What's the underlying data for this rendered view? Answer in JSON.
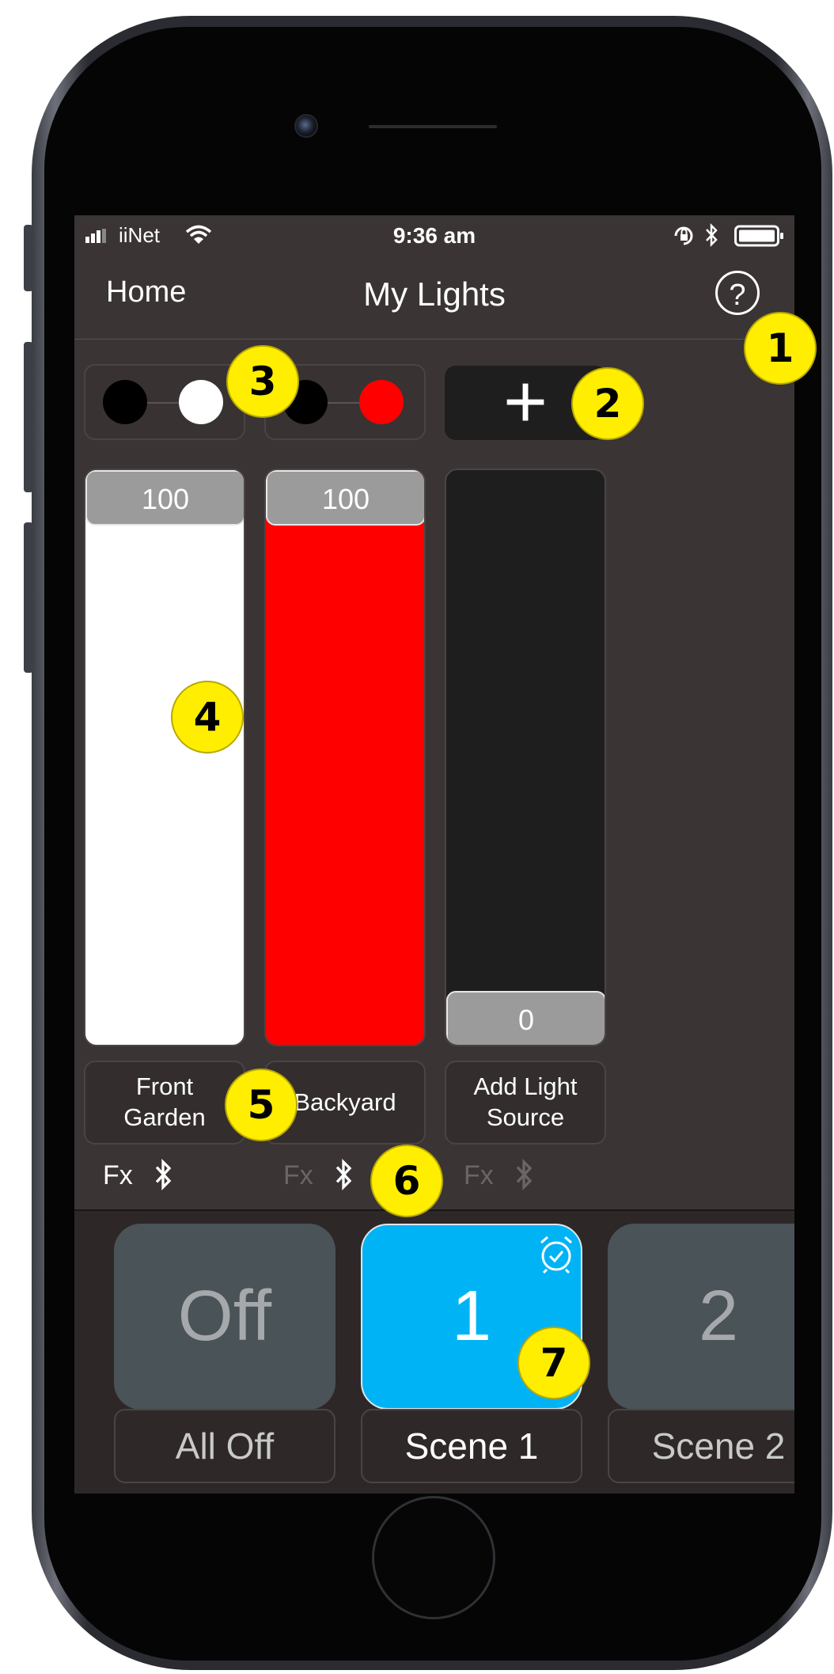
{
  "status_bar": {
    "carrier": "iiNet",
    "time": "9:36 am"
  },
  "nav": {
    "back_label": "Home",
    "title": "My Lights",
    "help_glyph": "?"
  },
  "lights": [
    {
      "name_line1": "Front",
      "name_line2": "Garden",
      "level": "100",
      "level_fraction": 1.0,
      "color": "#ffffff",
      "fx_label": "Fx",
      "fx_active": true
    },
    {
      "name_line1": "Backyard",
      "name_line2": "",
      "level": "100",
      "level_fraction": 1.0,
      "color": "#ff0000",
      "fx_label": "Fx",
      "fx_active": false
    },
    {
      "name_line1": "Add Light",
      "name_line2": "Source",
      "level": "0",
      "level_fraction": 0.0,
      "color": "#1e1e1e",
      "fx_label": "Fx",
      "fx_active": false
    }
  ],
  "add_button_glyph": "+",
  "scenes": [
    {
      "tile_label": "Off",
      "name": "All Off",
      "active": false
    },
    {
      "tile_label": "1",
      "name": "Scene 1",
      "active": true,
      "has_alarm_icon": true
    },
    {
      "tile_label": "2",
      "name": "Scene 2",
      "active": false
    }
  ],
  "colors": {
    "accent": "#00b3f5",
    "callout": "#ffee00",
    "screen_bg": "#3a3434"
  },
  "callouts": [
    "1",
    "2",
    "3",
    "4",
    "5",
    "6",
    "7"
  ]
}
